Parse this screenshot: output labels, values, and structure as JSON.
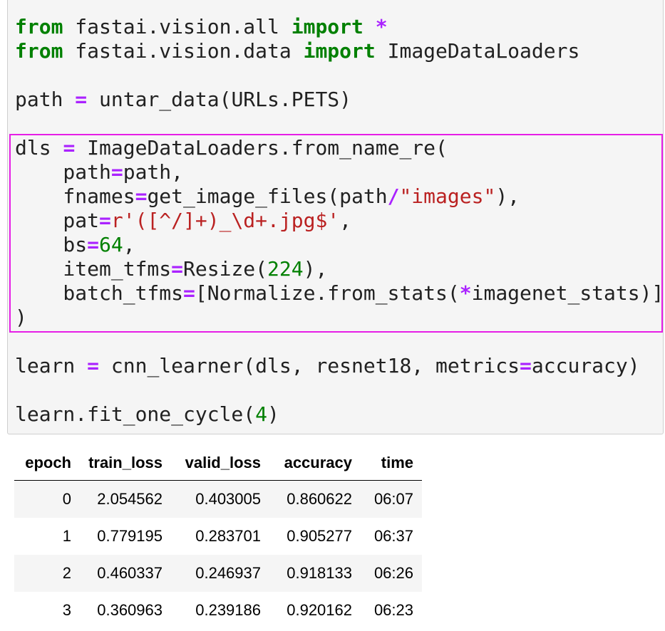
{
  "code": {
    "line1": {
      "kw_from": "from",
      "mod": " fastai.vision.all ",
      "kw_import": "import",
      "star": "*"
    },
    "line2": {
      "kw_from": "from",
      "mod": " fastai.vision.data ",
      "kw_import": "import",
      "name": " ImageDataLoaders"
    },
    "line4": {
      "lhs": "path ",
      "eq": "=",
      "rhs": " untar_data(URLs.PETS)"
    },
    "line6": {
      "lhs": "dls ",
      "eq": "=",
      "rhs": " ImageDataLoaders.from_name_re("
    },
    "line7": {
      "name": "    path",
      "eq": "=",
      "rhs": "path,"
    },
    "line8": {
      "name": "    fnames",
      "eq": "=",
      "call": "get_image_files(path",
      "slash": "/",
      "str": "\"images\"",
      "end": "),"
    },
    "line9": {
      "name": "    pat",
      "eq": "=",
      "str": "r'([^/]+)_\\d+.jpg$'",
      "end": ","
    },
    "line10": {
      "name": "    bs",
      "eq": "=",
      "num": "64",
      "end": ","
    },
    "line11": {
      "name": "    item_tfms",
      "eq": "=",
      "call": "Resize(",
      "num": "224",
      "end": "),"
    },
    "line12": {
      "name": "    batch_tfms",
      "eq": "=",
      "call": "[Normalize.from_stats(",
      "star": "*",
      "end": "imagenet_stats)]"
    },
    "line13": {
      "text": ")"
    },
    "line15": {
      "lhs": "learn ",
      "eq": "=",
      "call": " cnn_learner(dls, resnet18, metrics",
      "eq2": "=",
      "end": "accuracy)"
    },
    "line17": {
      "call": "learn.fit_one_cycle(",
      "num": "4",
      "end": ")"
    }
  },
  "results": {
    "headers": [
      "epoch",
      "train_loss",
      "valid_loss",
      "accuracy",
      "time"
    ],
    "rows": [
      [
        "0",
        "2.054562",
        "0.403005",
        "0.860622",
        "06:07"
      ],
      [
        "1",
        "0.779195",
        "0.283701",
        "0.905277",
        "06:37"
      ],
      [
        "2",
        "0.460337",
        "0.246937",
        "0.918133",
        "06:26"
      ],
      [
        "3",
        "0.360963",
        "0.239186",
        "0.920162",
        "06:23"
      ]
    ]
  },
  "colors": {
    "keyword": "#008000",
    "operator": "#aa22ff",
    "string": "#ba2121",
    "number": "#008000",
    "highlight_border": "#e61ee6",
    "cell_background": "#f5f5f5"
  }
}
